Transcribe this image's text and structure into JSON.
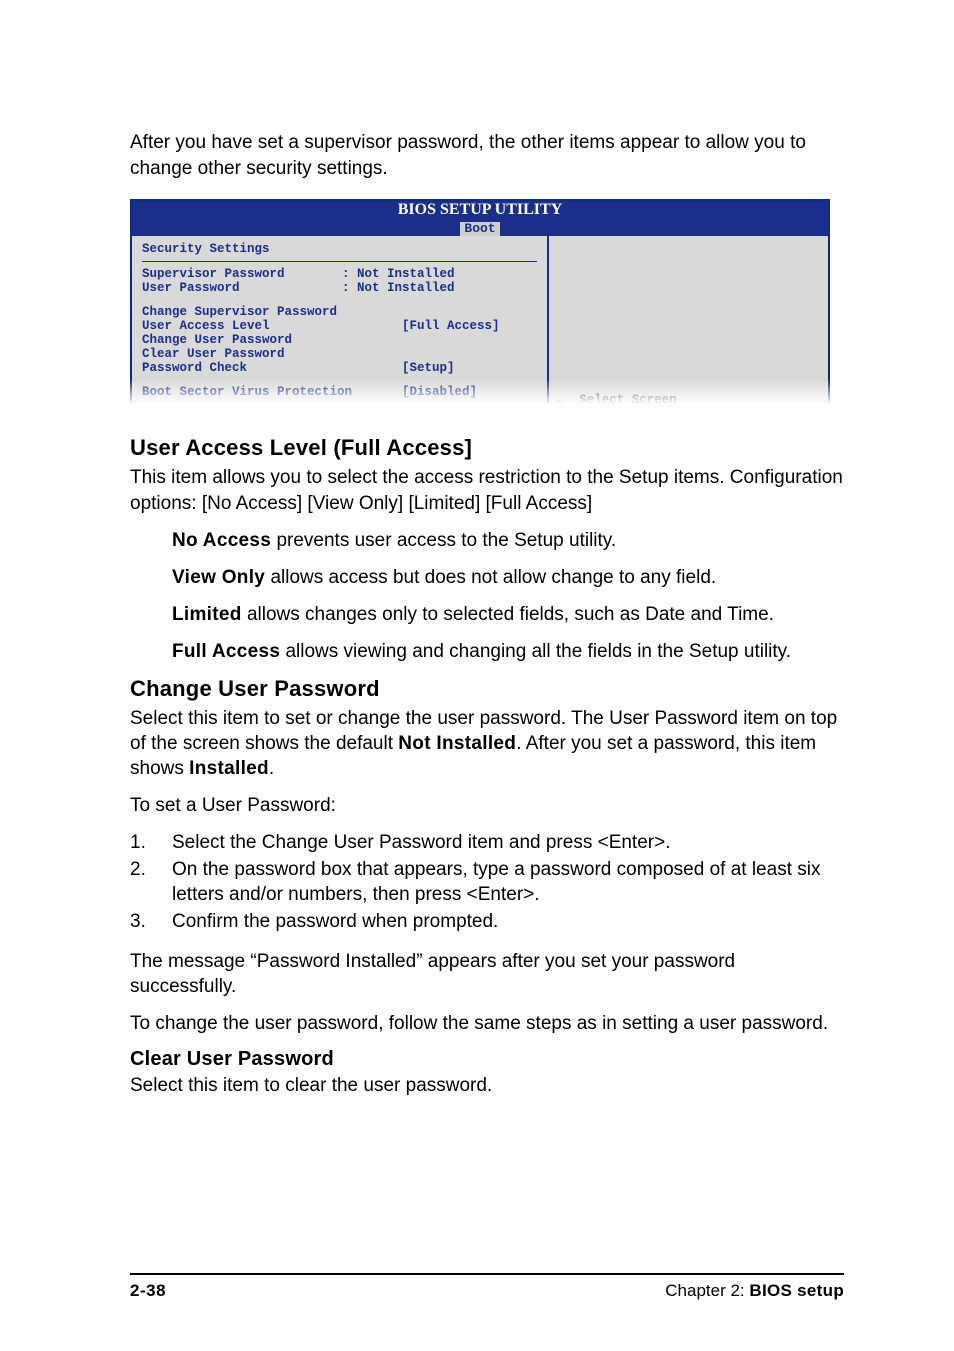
{
  "intro": "After you have set a supervisor password, the other items appear to allow you to change other security settings.",
  "bios": {
    "title": "BIOS SETUP UTILITY",
    "tab": "Boot",
    "section_header": "Security Settings",
    "status": [
      {
        "label": "Supervisor Password",
        "value": ": Not Installed"
      },
      {
        "label": "User Password",
        "value": ": Not Installed"
      }
    ],
    "items": [
      {
        "label": "Change Supervisor Password",
        "value": ""
      },
      {
        "label": "User Access Level",
        "value": "[Full Access]"
      },
      {
        "label": "Change User Password",
        "value": ""
      },
      {
        "label": "Clear User Password",
        "value": ""
      },
      {
        "label": "Password Check",
        "value": "[Setup]"
      }
    ],
    "boot_item": {
      "label": "Boot Sector Virus Protection",
      "value": "[Disabled]"
    },
    "help_text": "Select Screen"
  },
  "sections": {
    "ual": {
      "heading": "User Access Level (Full Access]",
      "desc": "This item allows you to select the access restriction to the Setup items. Configuration options: [No Access] [View Only] [Limited] [Full Access]",
      "opts": [
        {
          "name": "No Access",
          "text": " prevents user access to the Setup utility."
        },
        {
          "name": "View Only",
          "text": " allows access but does not allow change to any field."
        },
        {
          "name": "Limited",
          "text": " allows changes only to selected fields, such as Date and Time."
        },
        {
          "name": "Full Access",
          "text": " allows viewing and changing all the fields in the Setup utility."
        }
      ]
    },
    "cup": {
      "heading": "Change User Password",
      "p1a": "Select this item to set or change the user password. The User Password item on top of the screen shows the default ",
      "p1b": "Not Installed",
      "p1c": ". After you set a password, this item shows ",
      "p1d": "Installed",
      "p1e": ".",
      "p2": "To set a User Password:",
      "steps": [
        "Select the Change User Password item and press <Enter>.",
        "On the password box that appears, type a password composed of at least six letters and/or numbers, then press <Enter>.",
        "Confirm the password when prompted."
      ],
      "p3": "The message “Password Installed” appears after you set your password successfully.",
      "p4": "To change the user password, follow the same steps as in setting a user password."
    },
    "clr": {
      "heading": "Clear User Password",
      "p1": "Select this item to clear the user password."
    }
  },
  "footer": {
    "page": "2-38",
    "chapter_prefix": "Chapter 2: ",
    "chapter_bold": "BIOS setup"
  }
}
